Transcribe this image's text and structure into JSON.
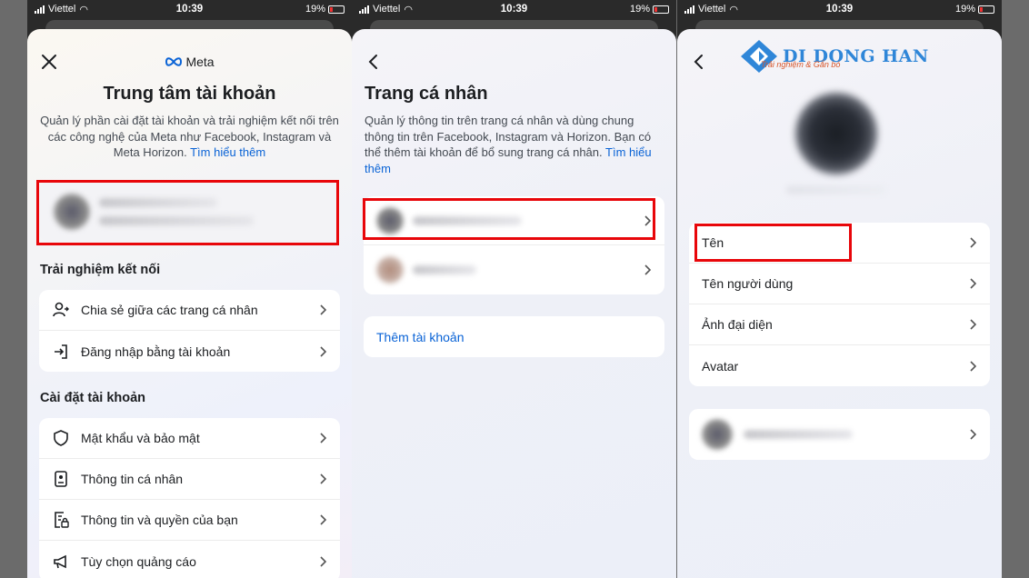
{
  "status": {
    "carrier": "Viettel",
    "time": "10:39",
    "battery": "19%"
  },
  "screen1": {
    "logo_text": "Meta",
    "title": "Trung tâm tài khoản",
    "description": "Quản lý phần cài đặt tài khoản và trải nghiệm kết nối trên các công nghệ của Meta như Facebook, Instagram và Meta Horizon.",
    "learn_more": "Tìm hiểu thêm",
    "section_connected": "Trải nghiệm kết nối",
    "connected_items": [
      {
        "label": "Chia sẻ giữa các trang cá nhân",
        "icon": "person-share-icon"
      },
      {
        "label": "Đăng nhập bằng tài khoản",
        "icon": "login-arrow-icon"
      }
    ],
    "section_settings": "Cài đặt tài khoản",
    "settings_items": [
      {
        "label": "Mật khẩu và bảo mật",
        "icon": "shield-icon"
      },
      {
        "label": "Thông tin cá nhân",
        "icon": "id-card-icon"
      },
      {
        "label": "Thông tin và quyền của bạn",
        "icon": "document-lock-icon"
      },
      {
        "label": "Tùy chọn quảng cáo",
        "icon": "megaphone-icon"
      }
    ]
  },
  "screen2": {
    "title": "Trang cá nhân",
    "description": "Quản lý thông tin trên trang cá nhân và dùng chung thông tin trên Facebook, Instagram và Horizon. Bạn có thể thêm tài khoản để bổ sung trang cá nhân.",
    "learn_more": "Tìm hiểu thêm",
    "add_account": "Thêm tài khoản"
  },
  "screen3": {
    "watermark_title": "DI DONG HAN",
    "watermark_subtitle": "Trải nghiệm & Gắn bó",
    "items": [
      {
        "label": "Tên"
      },
      {
        "label": "Tên người dùng"
      },
      {
        "label": "Ảnh đại diện"
      },
      {
        "label": "Avatar"
      }
    ]
  },
  "colors": {
    "highlight": "#e8060a",
    "link": "#0a63d6",
    "watermark": "#2f86d8"
  }
}
